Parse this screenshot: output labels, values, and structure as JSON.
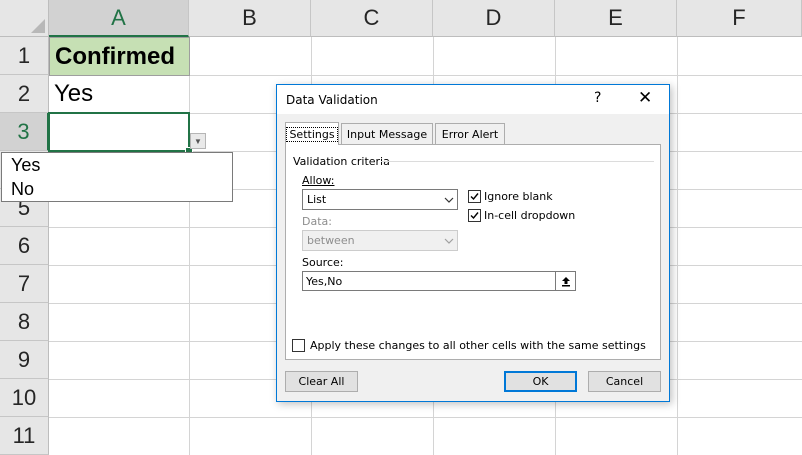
{
  "sheet": {
    "columns": [
      "A",
      "B",
      "C",
      "D",
      "E",
      "F"
    ],
    "rows": [
      "1",
      "2",
      "3",
      "4",
      "5",
      "6",
      "7",
      "8",
      "9",
      "10",
      "11"
    ],
    "cells": {
      "A1": "Confirmed",
      "A2": "Yes",
      "A3": ""
    },
    "active_cell": "A3",
    "header_fill_color": "#c6e0b4",
    "selection_color": "#217346"
  },
  "dropdown_list": {
    "items": [
      "Yes",
      "No"
    ]
  },
  "dialog": {
    "title": "Data Validation",
    "help_glyph": "?",
    "close_glyph": "✕",
    "tabs": [
      "Settings",
      "Input Message",
      "Error Alert"
    ],
    "active_tab": "Settings",
    "criteria_label": "Validation criteria",
    "allow_label": "Allow:",
    "allow_value": "List",
    "data_label": "Data:",
    "data_value": "between",
    "ignore_blank": {
      "label": "Ignore blank",
      "checked": true
    },
    "in_cell_dropdown": {
      "label": "In-cell dropdown",
      "checked": true
    },
    "source_label": "Source:",
    "source_value": "Yes,No",
    "apply_all": {
      "label": "Apply these changes to all other cells with the same settings",
      "checked": false
    },
    "buttons": {
      "clear_all": "Clear All",
      "ok": "OK",
      "cancel": "Cancel"
    },
    "accent_color": "#0078d7"
  }
}
